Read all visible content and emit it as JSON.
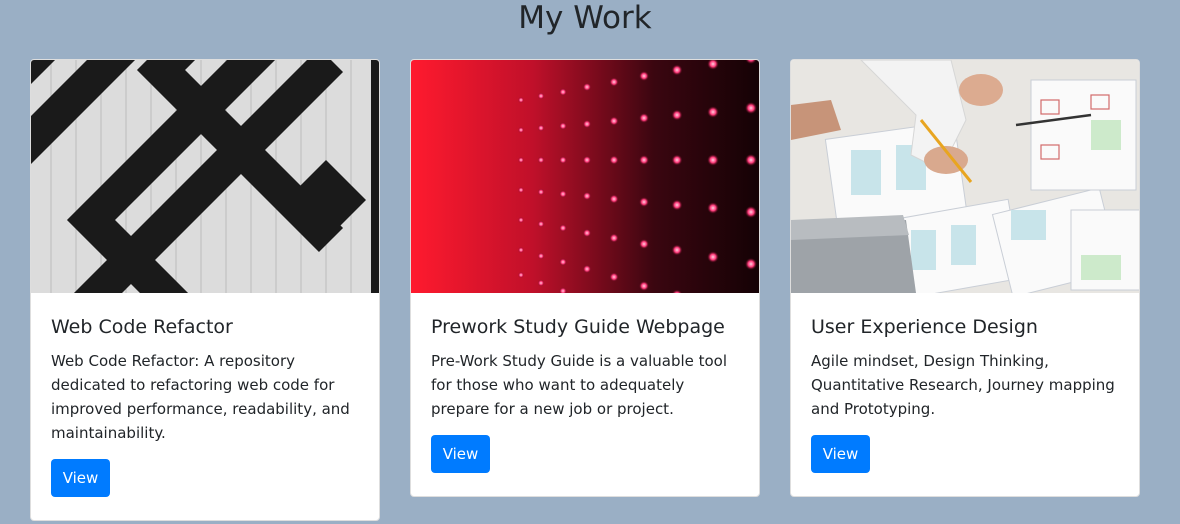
{
  "section": {
    "title": "My Work"
  },
  "cards": [
    {
      "title": "Web Code Refactor",
      "description": "Web Code Refactor: A repository dedicated to refactoring web code for improved performance, readability, and maintainability.",
      "button_label": "View"
    },
    {
      "title": "Prework Study Guide Webpage",
      "description": "Pre-Work Study Guide is a valuable tool for those who want to adequately prepare for a new job or project.",
      "button_label": "View"
    },
    {
      "title": "User Experience Design",
      "description": "Agile mindset, Design Thinking, Quantitative Research, Journey mapping and Prototyping.",
      "button_label": "View"
    }
  ],
  "colors": {
    "background": "#9aafc5",
    "button": "#007bff",
    "text": "#212529"
  }
}
